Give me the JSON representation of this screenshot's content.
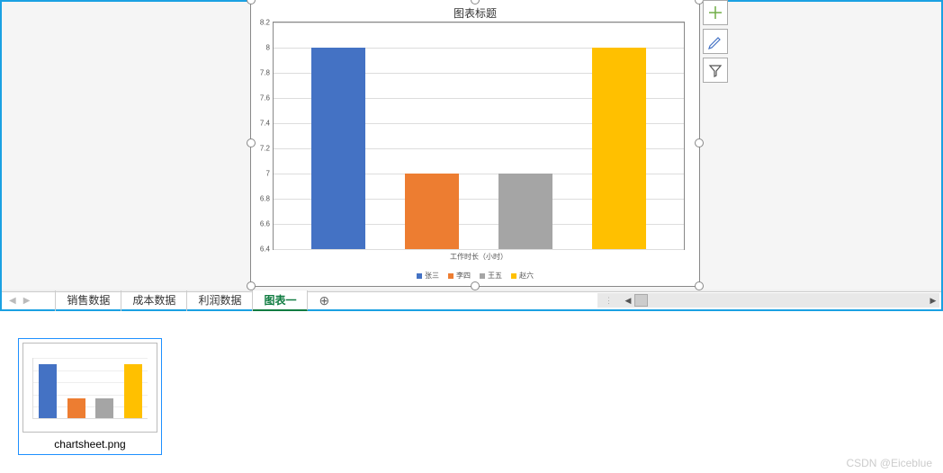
{
  "chart_data": {
    "type": "bar",
    "title": "图表标题",
    "categories": [
      "张三",
      "李四",
      "王五",
      "赵六"
    ],
    "values": [
      8,
      7,
      7,
      8
    ],
    "xlabel": "工作时长（小时）",
    "ylabel": "",
    "ylim": [
      6.4,
      8.2
    ],
    "yticks": [
      6.4,
      6.6,
      6.8,
      7,
      7.2,
      7.4,
      7.6,
      7.8,
      8,
      8.2
    ],
    "colors": [
      "#4472c4",
      "#ed7d31",
      "#a5a5a5",
      "#ffc000"
    ],
    "legend_labels": [
      "张三",
      "李四",
      "王五",
      "赵六"
    ]
  },
  "sheet_tabs": {
    "nav_prev": "◀",
    "nav_next": "▶",
    "items": [
      "销售数据",
      "成本数据",
      "利润数据",
      "图表一"
    ],
    "active_index": 3,
    "add_label": "⊕"
  },
  "chart_tools": {
    "plus": "plus-icon",
    "brush": "brush-icon",
    "filter": "filter-icon"
  },
  "thumbnail": {
    "filename": "chartsheet.png"
  },
  "watermark": "CSDN @Eiceblue"
}
